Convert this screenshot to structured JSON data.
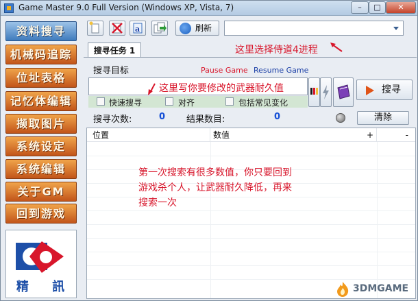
{
  "window": {
    "title": "Game Master 9.0 Full Version (Windows XP, Vista, 7)",
    "minimize": "–",
    "maximize": "□",
    "close": "✕"
  },
  "sidebar": {
    "items": [
      {
        "label": "资料搜寻",
        "active": true
      },
      {
        "label": "机械码追踪",
        "active": false
      },
      {
        "label": "位址表格",
        "active": false
      },
      {
        "label": "记忆体编辑",
        "active": false
      },
      {
        "label": "撷取图片",
        "active": false
      },
      {
        "label": "系统设定",
        "active": false
      },
      {
        "label": "系统编辑",
        "active": false
      },
      {
        "label": "关于GM",
        "active": false
      },
      {
        "label": "回到游戏",
        "active": false
      }
    ],
    "logo_text": "精 訊"
  },
  "toolbar": {
    "refresh_label": "刷新",
    "process_value": ""
  },
  "tabs": [
    {
      "label": "搜寻任务 1"
    }
  ],
  "search": {
    "target_label": "搜寻目标",
    "pause_label": "Pause Game",
    "resume_label": "Resume Game",
    "value": "",
    "options": [
      {
        "label": "快速搜寻",
        "checked": false
      },
      {
        "label": "对齐",
        "checked": false
      },
      {
        "label": "包括常见变化",
        "checked": false
      }
    ],
    "search_button": "搜寻",
    "count_label": "搜寻次数:",
    "count_value": "0",
    "result_label": "结果数目:",
    "result_value": "0",
    "clear_button": "清除"
  },
  "results": {
    "columns": [
      "位置",
      "数值",
      "+",
      "-"
    ],
    "rows": []
  },
  "annotations": {
    "process_note": "这里选择侍道4进程",
    "value_note": "这里写你要修改的武器耐久值",
    "body_note": "第一次搜索有很多数值，你只要回到游戏杀个人，让武器耐久降低，再来搜索一次"
  },
  "watermark": "3DMGAME",
  "colors": {
    "menu_orange": "#d9742c",
    "menu_active_blue": "#5b93d0",
    "annotation_red": "#d8162b",
    "count_blue": "#1650d6"
  }
}
